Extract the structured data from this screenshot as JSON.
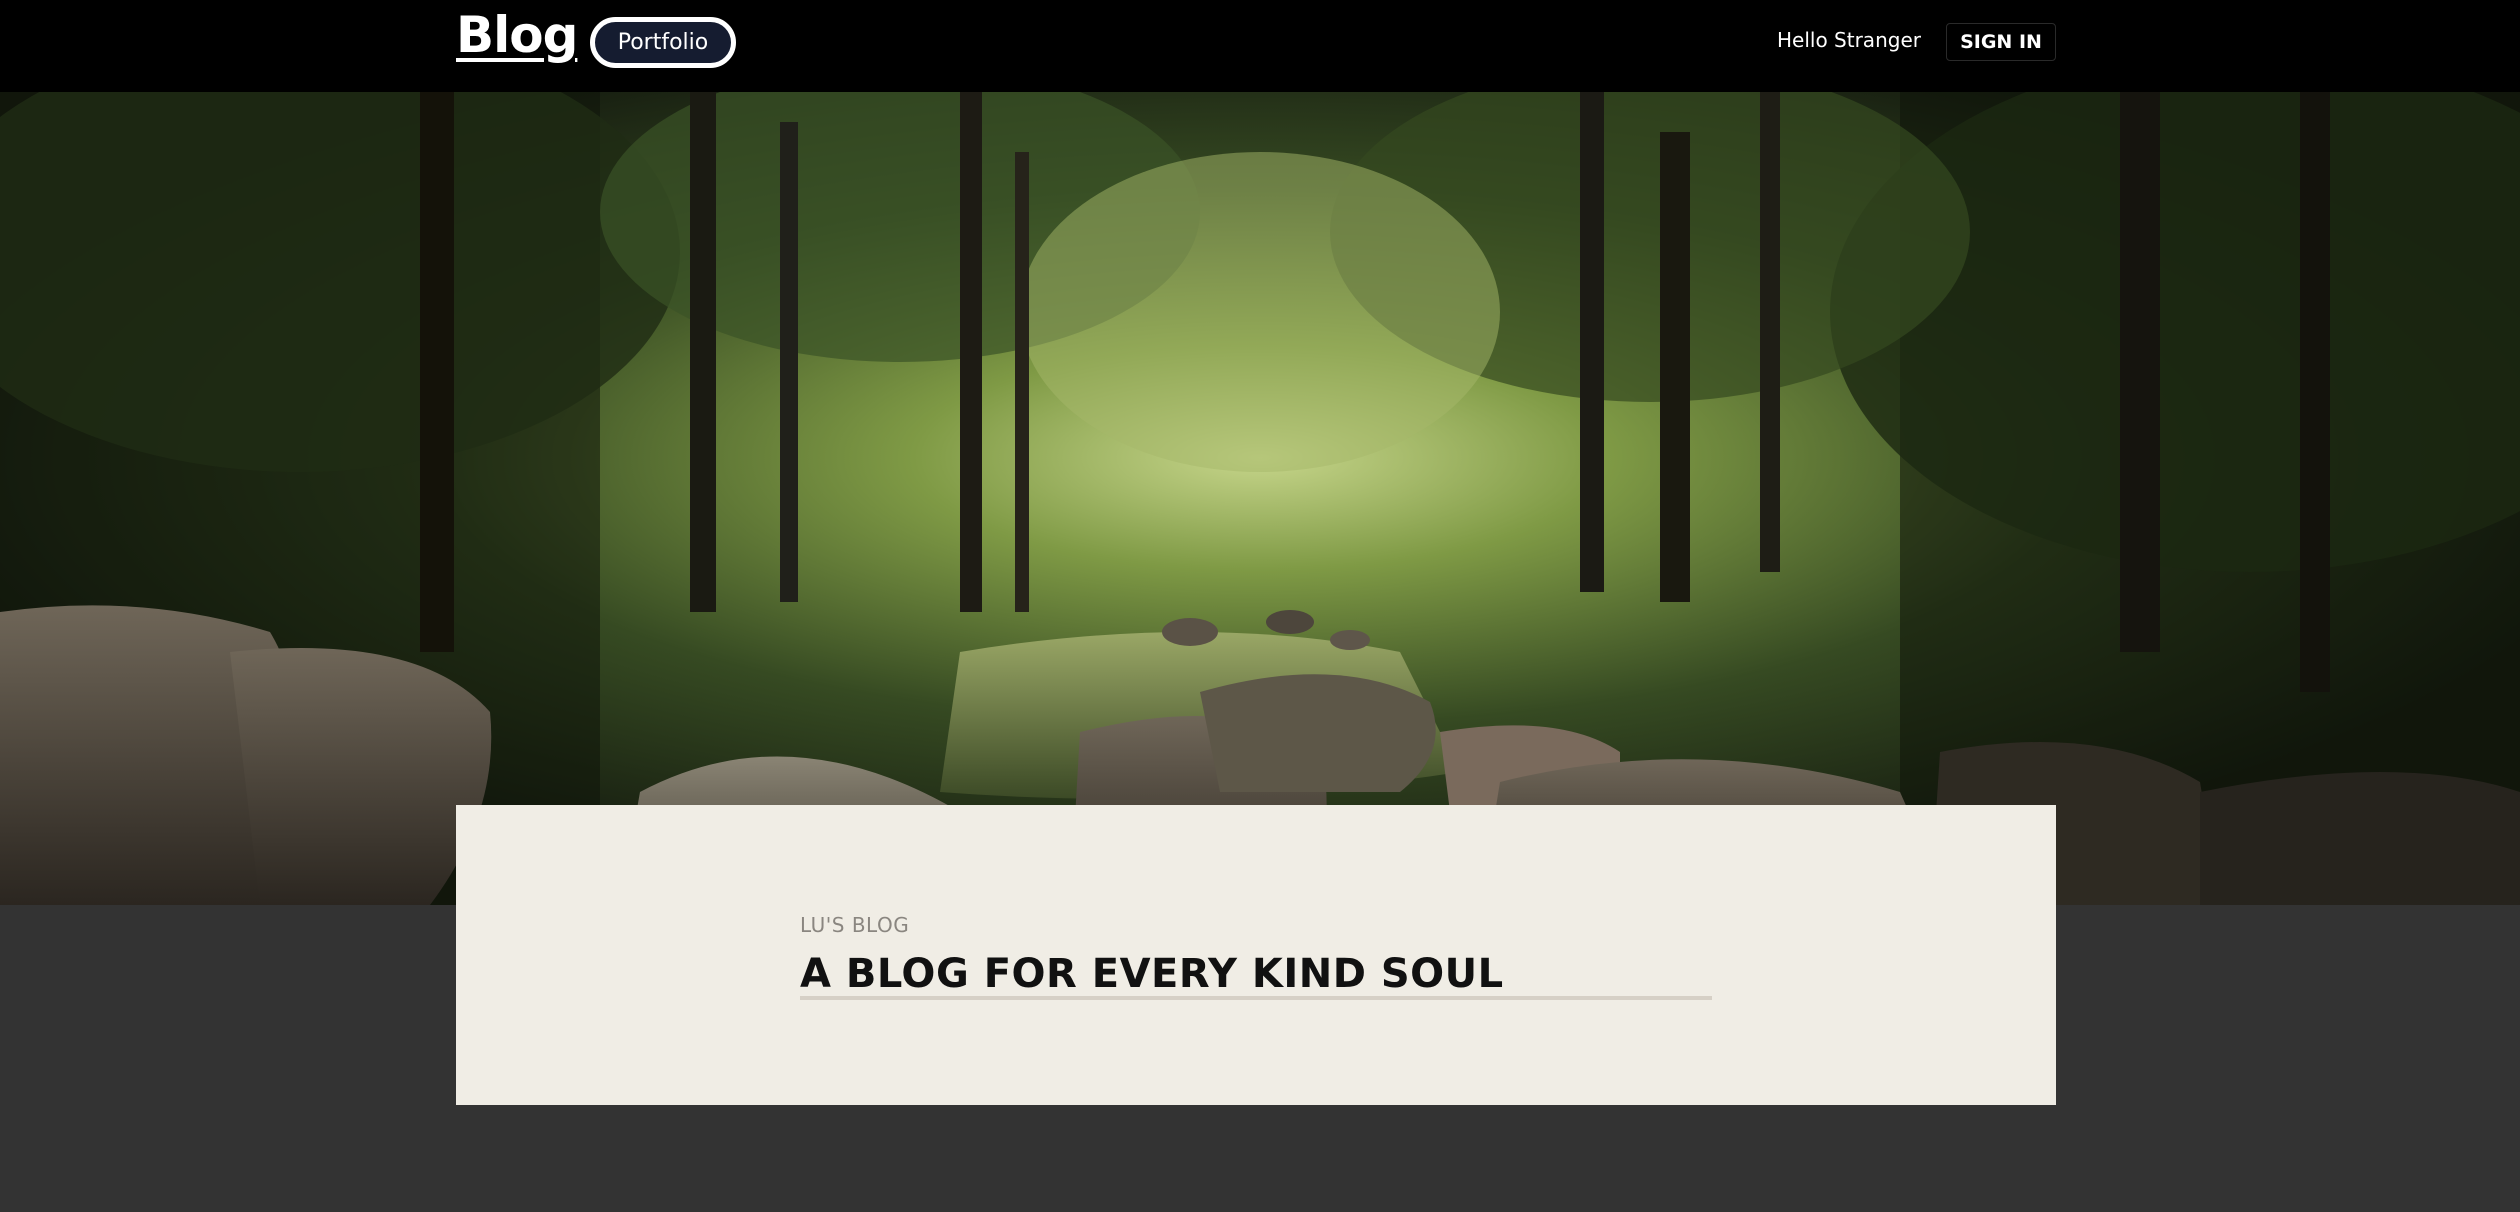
{
  "header": {
    "brand": "Blog",
    "portfolio_label": "Portfolio",
    "greeting": "Hello Stranger",
    "signin_label": "SIGN IN"
  },
  "hero": {
    "image": "forest-stream-photo"
  },
  "card": {
    "eyebrow": "LU'S BLOG",
    "title": "A BLOG FOR EVERY KIND SOUL"
  },
  "colors": {
    "topbar": "#000000",
    "portfolio_bg": "#151c30",
    "card_bg": "#f0ede5",
    "page_bg": "#333333",
    "title_rule": "#d6d0c6"
  }
}
